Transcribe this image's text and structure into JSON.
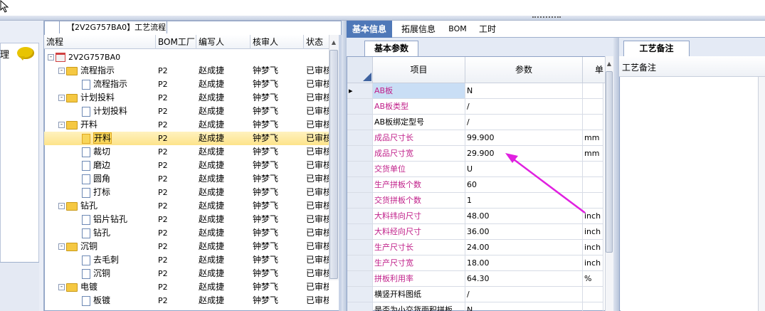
{
  "tree_tab_title": "【2V2G757BA0】工艺流程",
  "tree_headers": {
    "flow": "流程",
    "bom": "BOM工厂",
    "writer": "编写人",
    "reviewer": "核审人",
    "status": "状态"
  },
  "tree_rows": [
    {
      "name": "2V2G757BA0",
      "level": 0,
      "kind": "root",
      "expand": "-",
      "bom": "",
      "writer": "",
      "reviewer": "",
      "status": ""
    },
    {
      "name": "流程指示",
      "level": 1,
      "kind": "folder",
      "expand": "-",
      "bom": "P2",
      "writer": "赵成捷",
      "reviewer": "钟梦飞",
      "status": "已审核"
    },
    {
      "name": "流程指示",
      "level": 2,
      "kind": "doc",
      "expand": "",
      "bom": "P2",
      "writer": "赵成捷",
      "reviewer": "钟梦飞",
      "status": "已审核"
    },
    {
      "name": "计划投料",
      "level": 1,
      "kind": "folder",
      "expand": "-",
      "bom": "P2",
      "writer": "赵成捷",
      "reviewer": "钟梦飞",
      "status": "已审核"
    },
    {
      "name": "计划投料",
      "level": 2,
      "kind": "doc",
      "expand": "",
      "bom": "P2",
      "writer": "赵成捷",
      "reviewer": "钟梦飞",
      "status": "已审核"
    },
    {
      "name": "开料",
      "level": 1,
      "kind": "folder",
      "expand": "-",
      "bom": "P2",
      "writer": "赵成捷",
      "reviewer": "钟梦飞",
      "status": "已审核"
    },
    {
      "name": "开料",
      "level": 2,
      "kind": "doc",
      "expand": "",
      "bom": "P2",
      "writer": "赵成捷",
      "reviewer": "钟梦飞",
      "status": "已审核",
      "selected": true
    },
    {
      "name": "裁切",
      "level": 2,
      "kind": "doc",
      "expand": "",
      "bom": "P2",
      "writer": "赵成捷",
      "reviewer": "钟梦飞",
      "status": "已审核"
    },
    {
      "name": "磨边",
      "level": 2,
      "kind": "doc",
      "expand": "",
      "bom": "P2",
      "writer": "赵成捷",
      "reviewer": "钟梦飞",
      "status": "已审核"
    },
    {
      "name": "圆角",
      "level": 2,
      "kind": "doc",
      "expand": "",
      "bom": "P2",
      "writer": "赵成捷",
      "reviewer": "钟梦飞",
      "status": "已审核"
    },
    {
      "name": "打标",
      "level": 2,
      "kind": "doc",
      "expand": "",
      "bom": "P2",
      "writer": "赵成捷",
      "reviewer": "钟梦飞",
      "status": "已审核"
    },
    {
      "name": "钻孔",
      "level": 1,
      "kind": "folder",
      "expand": "-",
      "bom": "P2",
      "writer": "赵成捷",
      "reviewer": "钟梦飞",
      "status": "已审核"
    },
    {
      "name": "铝片钻孔",
      "level": 2,
      "kind": "doc",
      "expand": "",
      "bom": "P2",
      "writer": "赵成捷",
      "reviewer": "钟梦飞",
      "status": "已审核"
    },
    {
      "name": "钻孔",
      "level": 2,
      "kind": "doc",
      "expand": "",
      "bom": "P2",
      "writer": "赵成捷",
      "reviewer": "钟梦飞",
      "status": "已审核"
    },
    {
      "name": "沉铜",
      "level": 1,
      "kind": "folder",
      "expand": "-",
      "bom": "P2",
      "writer": "赵成捷",
      "reviewer": "钟梦飞",
      "status": "已审核"
    },
    {
      "name": "去毛刺",
      "level": 2,
      "kind": "doc",
      "expand": "",
      "bom": "P2",
      "writer": "赵成捷",
      "reviewer": "钟梦飞",
      "status": "已审核"
    },
    {
      "name": "沉铜",
      "level": 2,
      "kind": "doc",
      "expand": "",
      "bom": "P2",
      "writer": "赵成捷",
      "reviewer": "钟梦飞",
      "status": "已审核"
    },
    {
      "name": "电镀",
      "level": 1,
      "kind": "folder",
      "expand": "-",
      "bom": "P2",
      "writer": "赵成捷",
      "reviewer": "钟梦飞",
      "status": "已审核"
    },
    {
      "name": "板镀",
      "level": 2,
      "kind": "doc",
      "expand": "",
      "bom": "P2",
      "writer": "赵成捷",
      "reviewer": "钟梦飞",
      "status": "已审核"
    }
  ],
  "top_tabs": [
    "基本信息",
    "拓展信息",
    "BOM",
    "工时"
  ],
  "sub_tab": "基本参数",
  "grid_headers": {
    "item": "项目",
    "param": "参数",
    "unit": "单"
  },
  "grid_rows": [
    {
      "item": "AB板",
      "value": "N",
      "unit": "",
      "color": "#c0208a",
      "current": true
    },
    {
      "item": "AB板类型",
      "value": "/",
      "unit": "",
      "color": "#c0208a"
    },
    {
      "item": "AB板绑定型号",
      "value": "/",
      "unit": "",
      "color": "#000000"
    },
    {
      "item": "成品尺寸长",
      "value": "99.900",
      "unit": "mm",
      "color": "#c0208a"
    },
    {
      "item": "成品尺寸宽",
      "value": "29.900",
      "unit": "mm",
      "color": "#c0208a"
    },
    {
      "item": "交货单位",
      "value": "U",
      "unit": "",
      "color": "#c0208a"
    },
    {
      "item": "生产拼板个数",
      "value": "60",
      "unit": "",
      "color": "#c0208a"
    },
    {
      "item": "交货拼板个数",
      "value": "1",
      "unit": "",
      "color": "#c0208a"
    },
    {
      "item": "大料纬向尺寸",
      "value": "48.00",
      "unit": "inch",
      "color": "#c0208a"
    },
    {
      "item": "大料经向尺寸",
      "value": "36.00",
      "unit": "inch",
      "color": "#c0208a"
    },
    {
      "item": "生产尺寸长",
      "value": "24.00",
      "unit": "inch",
      "color": "#c0208a"
    },
    {
      "item": "生产尺寸宽",
      "value": "18.00",
      "unit": "inch",
      "color": "#c0208a"
    },
    {
      "item": "拼板利用率",
      "value": "64.30",
      "unit": "%",
      "color": "#c0208a"
    },
    {
      "item": "横竖开料图纸",
      "value": "/",
      "unit": "",
      "color": "#000000"
    },
    {
      "item": "是否为小交货面积拼板",
      "value": "N",
      "unit": "",
      "color": "#000000"
    }
  ],
  "notes_tab": "工艺备注",
  "notes_header": "工艺备注",
  "accent_color": "#4f78b8",
  "arrow_color": "#e020e0"
}
